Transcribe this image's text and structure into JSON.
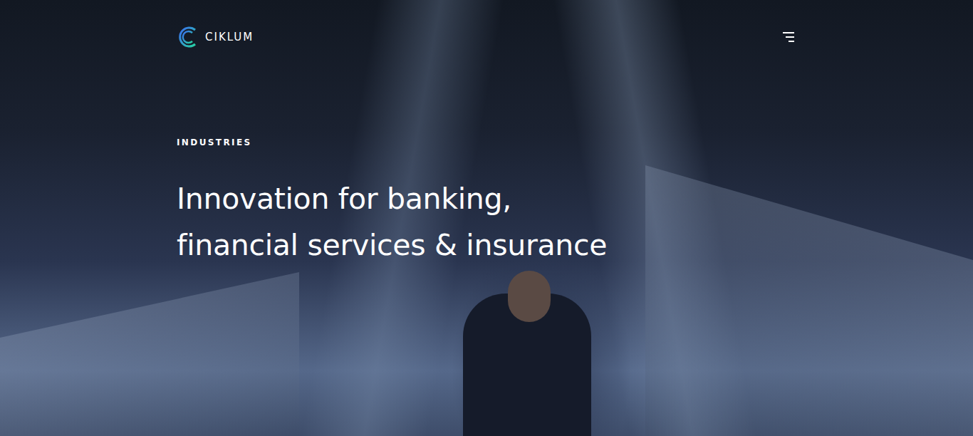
{
  "header": {
    "logo": "CIKLUM"
  },
  "hero": {
    "eyebrow": "INDUSTRIES",
    "headline": [
      "Innovation for banking,",
      "financial services & insurance"
    ]
  }
}
